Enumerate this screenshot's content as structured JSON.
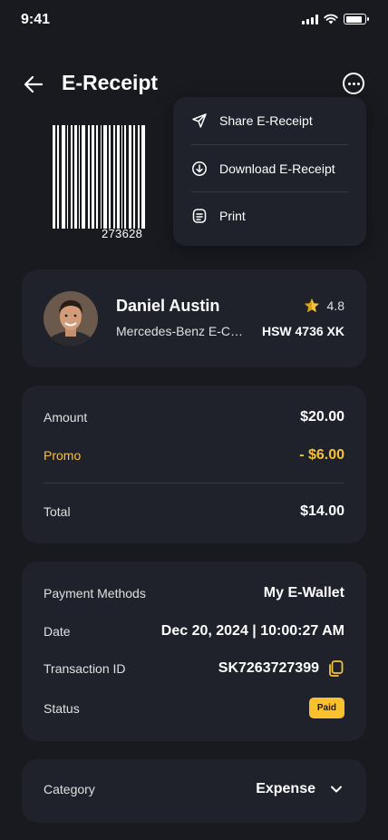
{
  "status_bar": {
    "time": "9:41"
  },
  "header": {
    "title": "E-Receipt"
  },
  "barcode": {
    "number": "273628"
  },
  "menu": {
    "items": [
      {
        "label": "Share E-Receipt",
        "icon": "send-icon"
      },
      {
        "label": "Download E-Receipt",
        "icon": "download-icon"
      },
      {
        "label": "Print",
        "icon": "document-icon"
      }
    ]
  },
  "driver": {
    "name": "Daniel Austin",
    "car": "Mercedes-Benz E-Class",
    "rating": "4.8",
    "plate": "HSW 4736 XK"
  },
  "amounts": {
    "amount_label": "Amount",
    "amount_value": "$20.00",
    "promo_label": "Promo",
    "promo_value": "- $6.00",
    "total_label": "Total",
    "total_value": "$14.00"
  },
  "payment": {
    "method_label": "Payment Methods",
    "method_value": "My E-Wallet",
    "date_label": "Date",
    "date_value": "Dec 20, 2024 | 10:00:27 AM",
    "txn_label": "Transaction ID",
    "txn_value": "SK7263727399",
    "status_label": "Status",
    "status_value": "Paid"
  },
  "category": {
    "label": "Category",
    "value": "Expense"
  },
  "colors": {
    "background": "#181a20",
    "card": "#1f222a",
    "accent": "#f7c13a",
    "badge": "#fbc02d"
  }
}
